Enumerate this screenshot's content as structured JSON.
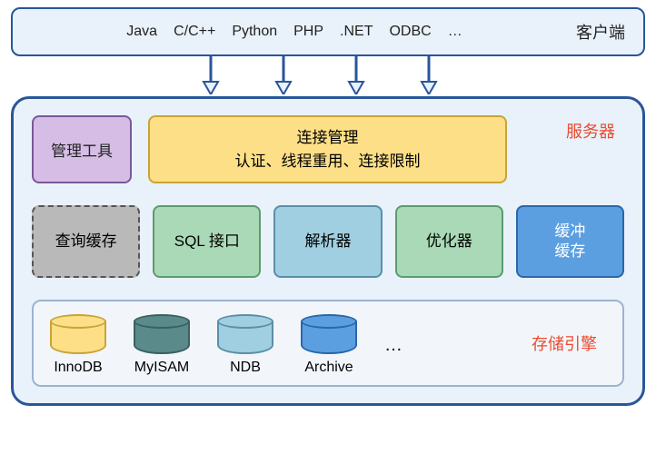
{
  "client": {
    "languages": [
      "Java",
      "C/C++",
      "Python",
      "PHP",
      ".NET",
      "ODBC",
      "…"
    ],
    "title": "客户端"
  },
  "server": {
    "label": "服务器",
    "mgmt_tool": "管理工具",
    "conn_mgr_line1": "连接管理",
    "conn_mgr_line2": "认证、线程重用、连接限制",
    "query_cache": "查询缓存",
    "sql_interface": "SQL 接口",
    "parser": "解析器",
    "optimizer": "优化器",
    "buffer_line1": "缓冲",
    "buffer_line2": "缓存"
  },
  "storage": {
    "label": "存储引擎",
    "engines": [
      {
        "name": "InnoDB",
        "class": "cyl-innodb"
      },
      {
        "name": "MyISAM",
        "class": "cyl-myisam"
      },
      {
        "name": "NDB",
        "class": "cyl-ndb"
      },
      {
        "name": "Archive",
        "class": "cyl-archive"
      }
    ],
    "ellipsis": "…"
  }
}
